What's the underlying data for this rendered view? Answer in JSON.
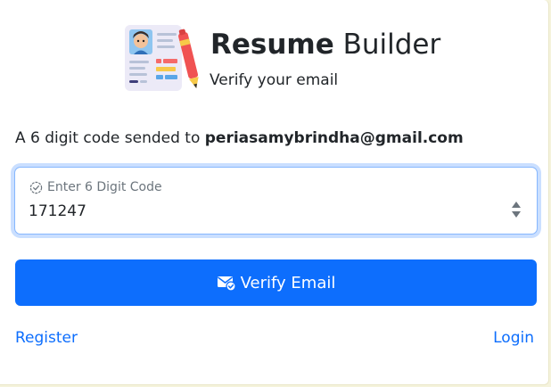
{
  "brand": {
    "title_bold": "Resume",
    "title_light": "Builder",
    "subtitle": "Verify your email",
    "logo_icon": "resume-document-pen-icon"
  },
  "message": {
    "prefix": "A 6 digit code sended to",
    "email": "periasamybrindha@gmail.com"
  },
  "code_field": {
    "label": "Enter 6 Digit Code",
    "label_icon": "check-circle-icon",
    "value": "171247"
  },
  "verify_button": {
    "label": "Verify Email",
    "icon": "envelope-check-icon"
  },
  "links": {
    "register": "Register",
    "login": "Login"
  },
  "colors": {
    "primary": "#0d6efd",
    "focus_border": "#86b7fe",
    "text": "#212529",
    "muted": "#6c757d",
    "page_bg": "#f5f3dc"
  }
}
